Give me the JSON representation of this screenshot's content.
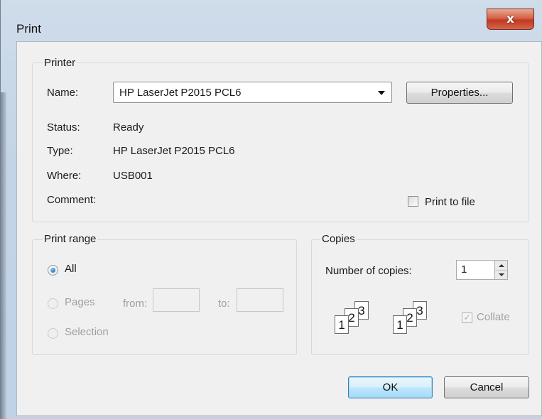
{
  "window": {
    "title": "Print",
    "close_glyph": "x"
  },
  "printer": {
    "group_label": "Printer",
    "name_label": "Name:",
    "name_value": "HP LaserJet P2015 PCL6",
    "properties_button": "Properties...",
    "status_label": "Status:",
    "status_value": "Ready",
    "type_label": "Type:",
    "type_value": "HP LaserJet P2015 PCL6",
    "where_label": "Where:",
    "where_value": "USB001",
    "comment_label": "Comment:",
    "print_to_file_label": "Print to file",
    "print_to_file_checked": false
  },
  "print_range": {
    "group_label": "Print range",
    "all_label": "All",
    "pages_label": "Pages",
    "from_label": "from:",
    "to_label": "to:",
    "selection_label": "Selection",
    "selected": "All"
  },
  "copies": {
    "group_label": "Copies",
    "number_label": "Number of copies:",
    "number_value": "1",
    "collate_label": "Collate",
    "collate_checked": true,
    "collate_pages": [
      "1",
      "2",
      "3"
    ]
  },
  "buttons": {
    "ok": "OK",
    "cancel": "Cancel"
  }
}
